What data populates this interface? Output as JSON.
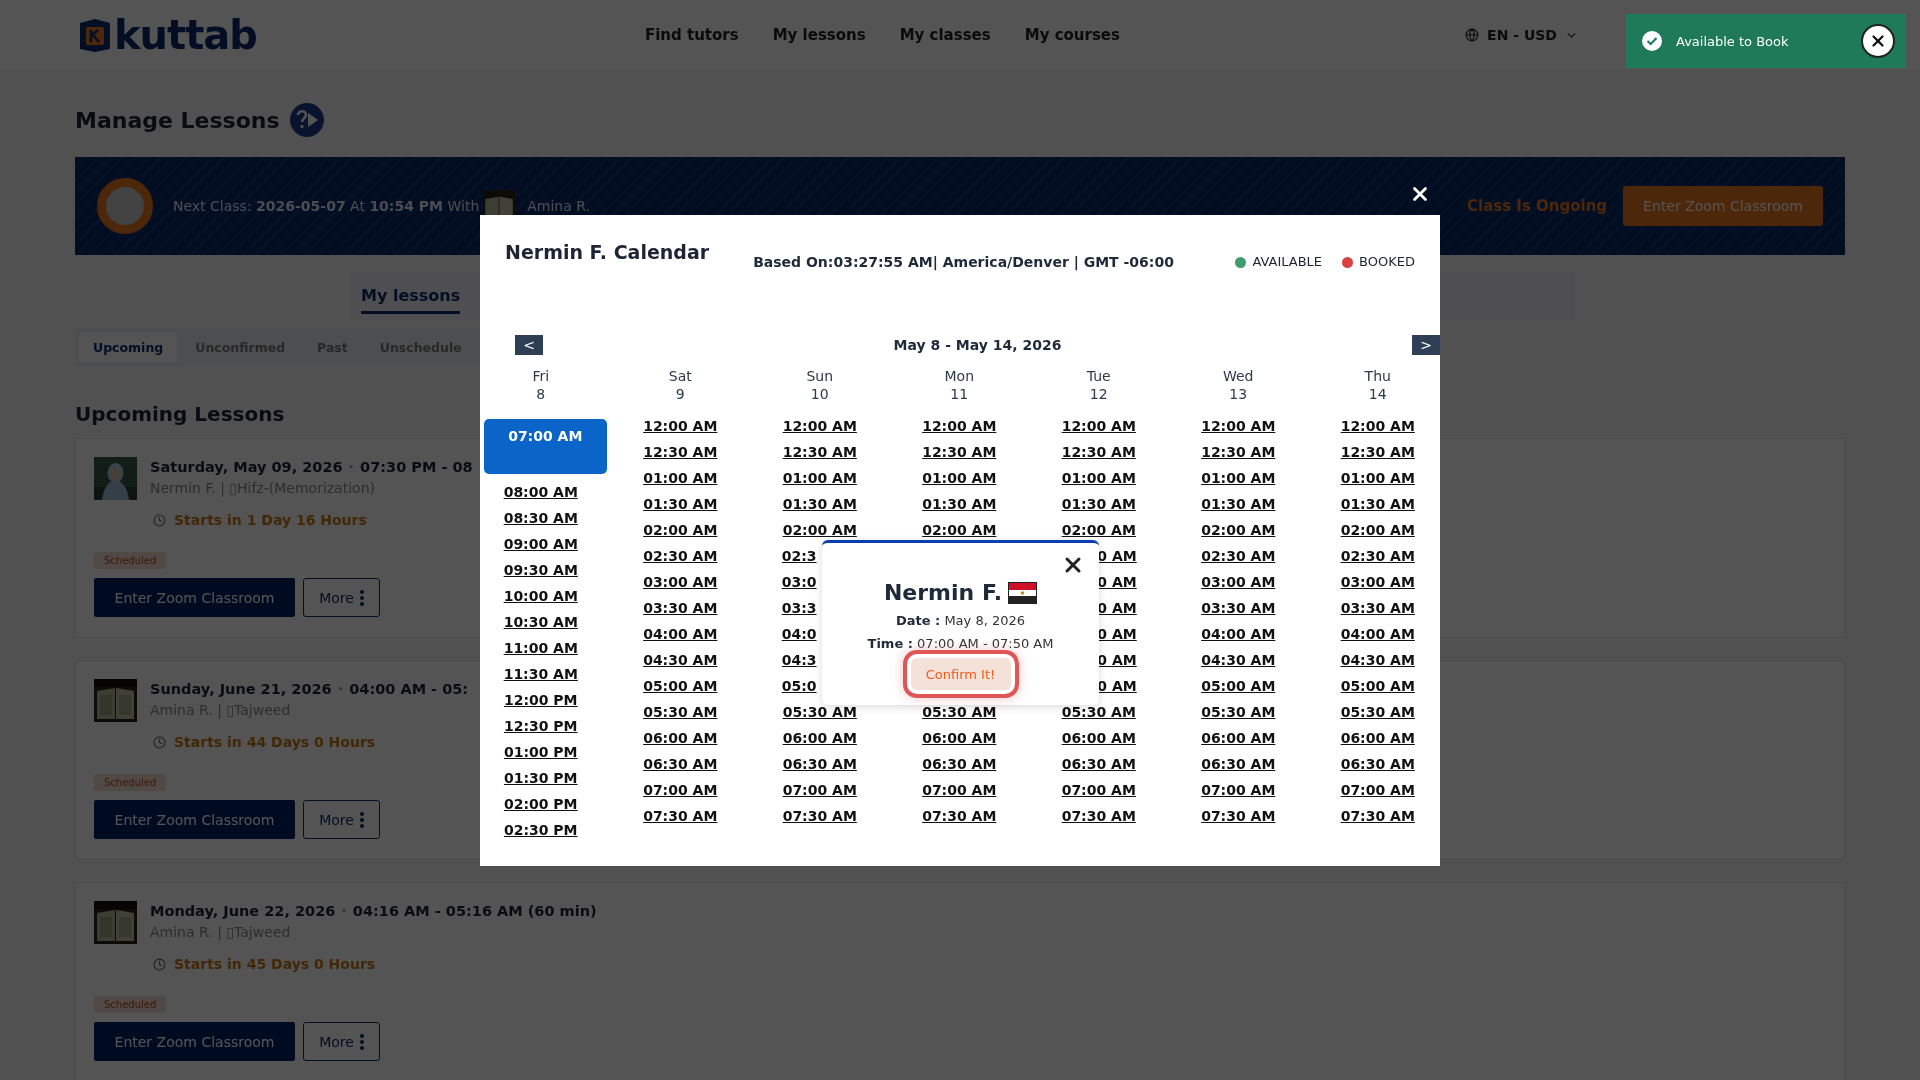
{
  "header": {
    "logo": "kuttab",
    "nav": [
      {
        "label": "Find tutors"
      },
      {
        "label": "My lessons"
      },
      {
        "label": "My classes"
      },
      {
        "label": "My courses"
      }
    ],
    "locale": "EN - USD"
  },
  "toast": {
    "message": "Available to Book"
  },
  "page_title": "Manage Lessons",
  "next_class": {
    "text": "Next Class: **2026-05-07** At **10:54 PM** With",
    "tutor": "Amina R.",
    "status": "Class Is Ongoing",
    "button": "Enter Zoom Classroom"
  },
  "main_tabs": [
    {
      "label": "My lessons",
      "selected": true
    }
  ],
  "filter_tabs": [
    {
      "label": "Upcoming",
      "selected": true
    },
    {
      "label": "Unconfirmed",
      "selected": false
    },
    {
      "label": "Past",
      "selected": false
    },
    {
      "label": "Unschedule",
      "selected": false
    }
  ],
  "section_title": "Upcoming Lessons",
  "lessons": [
    {
      "date": "Saturday, May 09, 2026",
      "separator": "·",
      "time": "07:30 PM - 08",
      "tutor_subject": "Nermin F. | ▯Hifz-(Memorization)",
      "countdown": "Starts in 1 Day 16 Hours",
      "status": "Scheduled",
      "primary_button": "Enter Zoom Classroom",
      "more_button": "More"
    },
    {
      "date": "Sunday, June 21, 2026",
      "separator": "·",
      "time": "04:00 AM - 05:",
      "tutor_subject": "Amina R. | ▯Tajweed",
      "countdown": "Starts in 44 Days 0 Hours",
      "status": "Scheduled",
      "primary_button": "Enter Zoom Classroom",
      "more_button": "More"
    },
    {
      "date": "Monday, June 22, 2026",
      "separator": "·",
      "time": "04:16 AM - 05:16 AM (60 min)",
      "tutor_subject": "Amina R. | ▯Tajweed",
      "countdown": "Starts in 45 Days 0 Hours",
      "status": "Scheduled",
      "primary_button": "Enter Zoom Classroom",
      "more_button": "More"
    }
  ],
  "calendar": {
    "title": "Nermin F. Calendar",
    "based_on": "Based On:03:27:55 AM| America/Denver | GMT -06:00",
    "legend": [
      {
        "label": "AVAILABLE",
        "color": "#3d9d6f"
      },
      {
        "label": "BOOKED",
        "color": "#d94040"
      }
    ],
    "prev": "<",
    "next": ">",
    "range": "May 8 - May 14, 2026",
    "days": [
      {
        "day": "Fri",
        "date": "8",
        "slots": [
          {
            "time": "07:00 AM",
            "selected": true
          },
          {
            "time": "08:00 AM",
            "selected": false
          },
          {
            "time": "08:30 AM",
            "selected": false
          },
          {
            "time": "09:00 AM",
            "selected": false
          },
          {
            "time": "09:30 AM",
            "selected": false
          },
          {
            "time": "10:00 AM",
            "selected": false
          },
          {
            "time": "10:30 AM",
            "selected": false
          },
          {
            "time": "11:00 AM",
            "selected": false
          },
          {
            "time": "11:30 AM",
            "selected": false
          },
          {
            "time": "12:00 PM",
            "selected": false
          },
          {
            "time": "12:30 PM",
            "selected": false
          },
          {
            "time": "01:00 PM",
            "selected": false
          },
          {
            "time": "01:30 PM",
            "selected": false
          },
          {
            "time": "02:00 PM",
            "selected": false
          },
          {
            "time": "02:30 PM",
            "selected": false
          }
        ]
      },
      {
        "day": "Sat",
        "date": "9",
        "slots": [
          {
            "time": "12:00 AM",
            "selected": false
          },
          {
            "time": "12:30 AM",
            "selected": false
          },
          {
            "time": "01:00 AM",
            "selected": false
          },
          {
            "time": "01:30 AM",
            "selected": false
          },
          {
            "time": "02:00 AM",
            "selected": false
          },
          {
            "time": "02:30 AM",
            "selected": false
          },
          {
            "time": "03:00 AM",
            "selected": false
          },
          {
            "time": "03:30 AM",
            "selected": false
          },
          {
            "time": "04:00 AM",
            "selected": false
          },
          {
            "time": "04:30 AM",
            "selected": false
          },
          {
            "time": "05:00 AM",
            "selected": false
          },
          {
            "time": "05:30 AM",
            "selected": false
          },
          {
            "time": "06:00 AM",
            "selected": false
          },
          {
            "time": "06:30 AM",
            "selected": false
          },
          {
            "time": "07:00 AM",
            "selected": false
          },
          {
            "time": "07:30 AM",
            "selected": false
          }
        ]
      },
      {
        "day": "Sun",
        "date": "10",
        "slots": [
          {
            "time": "12:00 AM",
            "selected": false
          },
          {
            "time": "12:30 AM",
            "selected": false
          },
          {
            "time": "01:00 AM",
            "selected": false
          },
          {
            "time": "01:30 AM",
            "selected": false
          },
          {
            "time": "02:00 AM",
            "selected": false
          },
          {
            "time": "02:3",
            "kind": "head",
            "selected": false
          },
          {
            "time": "03:0",
            "kind": "head",
            "selected": false
          },
          {
            "time": "03:3",
            "kind": "head",
            "selected": false
          },
          {
            "time": "04:0",
            "kind": "head",
            "selected": false
          },
          {
            "time": "04:3",
            "kind": "head",
            "selected": false
          },
          {
            "time": "05:0",
            "kind": "head",
            "selected": false
          },
          {
            "time": "05:30 AM",
            "selected": false
          },
          {
            "time": "06:00 AM",
            "selected": false
          },
          {
            "time": "06:30 AM",
            "selected": false
          },
          {
            "time": "07:00 AM",
            "selected": false
          },
          {
            "time": "07:30 AM",
            "selected": false
          }
        ]
      },
      {
        "day": "Mon",
        "date": "11",
        "slots": [
          {
            "time": "12:00 AM",
            "selected": false
          },
          {
            "time": "12:30 AM",
            "selected": false
          },
          {
            "time": "01:00 AM",
            "selected": false
          },
          {
            "time": "01:30 AM",
            "selected": false
          },
          {
            "time": "02:00 AM",
            "selected": false
          },
          {
            "kind": "covered"
          },
          {
            "kind": "covered"
          },
          {
            "kind": "covered"
          },
          {
            "kind": "covered"
          },
          {
            "kind": "covered"
          },
          {
            "kind": "covered"
          },
          {
            "time": "05:30 AM",
            "selected": false
          },
          {
            "time": "06:00 AM",
            "selected": false
          },
          {
            "time": "06:30 AM",
            "selected": false
          },
          {
            "time": "07:00 AM",
            "selected": false
          },
          {
            "time": "07:30 AM",
            "selected": false
          }
        ]
      },
      {
        "day": "Tue",
        "date": "12",
        "slots": [
          {
            "time": "12:00 AM",
            "selected": false
          },
          {
            "time": "12:30 AM",
            "selected": false
          },
          {
            "time": "01:00 AM",
            "selected": false
          },
          {
            "time": "01:30 AM",
            "selected": false
          },
          {
            "time": "02:00 AM",
            "selected": false
          },
          {
            "time": "0 AM",
            "kind": "tail",
            "selected": false
          },
          {
            "time": "0 AM",
            "kind": "tail",
            "selected": false
          },
          {
            "time": "0 AM",
            "kind": "tail",
            "selected": false
          },
          {
            "time": "0 AM",
            "kind": "tail",
            "selected": false
          },
          {
            "time": "0 AM",
            "kind": "tail",
            "selected": false
          },
          {
            "time": "0 AM",
            "kind": "tail",
            "selected": false
          },
          {
            "time": "05:30 AM",
            "selected": false
          },
          {
            "time": "06:00 AM",
            "selected": false
          },
          {
            "time": "06:30 AM",
            "selected": false
          },
          {
            "time": "07:00 AM",
            "selected": false
          },
          {
            "time": "07:30 AM",
            "selected": false
          }
        ]
      },
      {
        "day": "Wed",
        "date": "13",
        "slots": [
          {
            "time": "12:00 AM",
            "selected": false
          },
          {
            "time": "12:30 AM",
            "selected": false
          },
          {
            "time": "01:00 AM",
            "selected": false
          },
          {
            "time": "01:30 AM",
            "selected": false
          },
          {
            "time": "02:00 AM",
            "selected": false
          },
          {
            "time": "02:30 AM",
            "selected": false
          },
          {
            "time": "03:00 AM",
            "selected": false
          },
          {
            "time": "03:30 AM",
            "selected": false
          },
          {
            "time": "04:00 AM",
            "selected": false
          },
          {
            "time": "04:30 AM",
            "selected": false
          },
          {
            "time": "05:00 AM",
            "selected": false
          },
          {
            "time": "05:30 AM",
            "selected": false
          },
          {
            "time": "06:00 AM",
            "selected": false
          },
          {
            "time": "06:30 AM",
            "selected": false
          },
          {
            "time": "07:00 AM",
            "selected": false
          },
          {
            "time": "07:30 AM",
            "selected": false
          }
        ]
      },
      {
        "day": "Thu",
        "date": "14",
        "slots": [
          {
            "time": "12:00 AM",
            "selected": false
          },
          {
            "time": "12:30 AM",
            "selected": false
          },
          {
            "time": "01:00 AM",
            "selected": false
          },
          {
            "time": "01:30 AM",
            "selected": false
          },
          {
            "time": "02:00 AM",
            "selected": false
          },
          {
            "time": "02:30 AM",
            "selected": false
          },
          {
            "time": "03:00 AM",
            "selected": false
          },
          {
            "time": "03:30 AM",
            "selected": false
          },
          {
            "time": "04:00 AM",
            "selected": false
          },
          {
            "time": "04:30 AM",
            "selected": false
          },
          {
            "time": "05:00 AM",
            "selected": false
          },
          {
            "time": "05:30 AM",
            "selected": false
          },
          {
            "time": "06:00 AM",
            "selected": false
          },
          {
            "time": "06:30 AM",
            "selected": false
          },
          {
            "time": "07:00 AM",
            "selected": false
          },
          {
            "time": "07:30 AM",
            "selected": false
          }
        ]
      }
    ]
  },
  "booking": {
    "name": "Nermin F.",
    "date_label": "Date :",
    "date": "May 8, 2026",
    "time_label": "Time :",
    "time": "07:00 AM - 07:50 AM",
    "button": "Confirm It!"
  }
}
